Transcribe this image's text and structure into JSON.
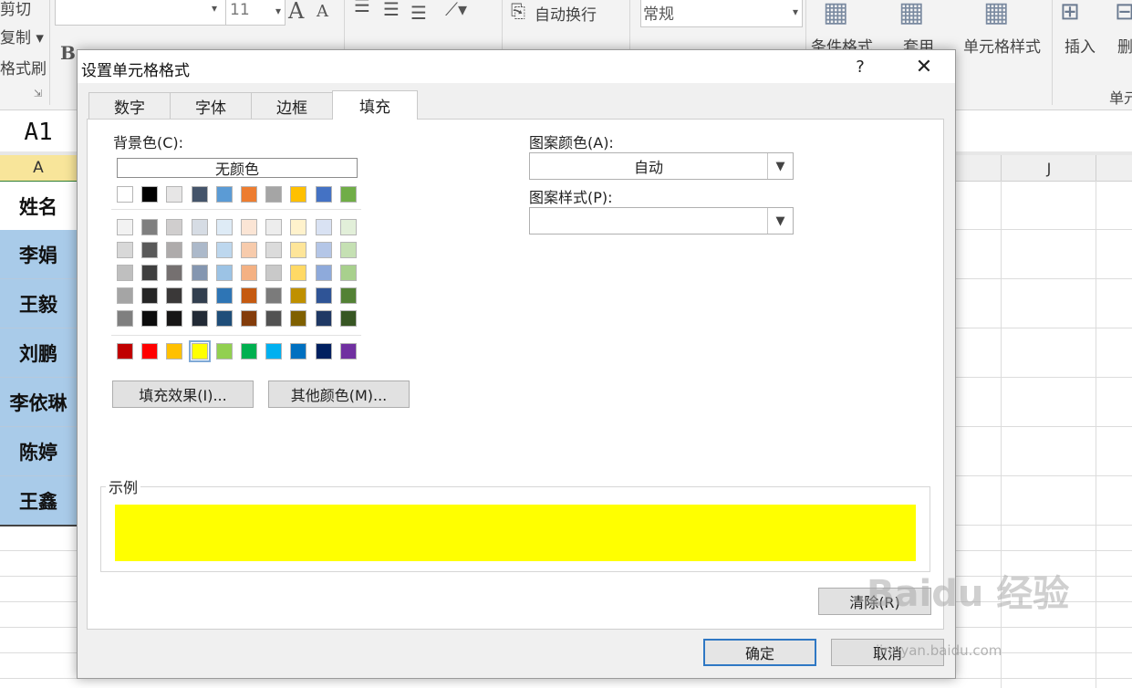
{
  "ribbon": {
    "clipboard": {
      "cut": "剪切",
      "copy": "复制 ▾",
      "format_painter": "格式刷"
    },
    "font": {
      "size": "11",
      "bold": "B",
      "grow": "A",
      "shrink": "A"
    },
    "alignment": {
      "wrap_text": "自动换行"
    },
    "number": {
      "format": "常规"
    },
    "styles": {
      "conditional_formatting": "条件格式",
      "format_as_table": "套用",
      "cell_styles": "单元格样式"
    },
    "cells": {
      "insert": "插入",
      "delete": "删",
      "group_label": "单元"
    }
  },
  "namebox": {
    "value": "A1"
  },
  "sheet": {
    "col_a": "A",
    "col_j": "J",
    "rows": [
      "姓名",
      "李娟",
      "王毅",
      "刘鹏",
      "李依琳",
      "陈婷",
      "王鑫"
    ]
  },
  "dialog": {
    "title": "设置单元格格式",
    "help": "?",
    "close": "✕",
    "tabs": [
      {
        "label": "数字"
      },
      {
        "label": "字体"
      },
      {
        "label": "边框"
      },
      {
        "label": "填充"
      }
    ],
    "active_tab": "填充",
    "fill": {
      "background_label": "背景色(C):",
      "no_color": "无颜色",
      "pattern_color_label": "图案颜色(A):",
      "pattern_color_value": "自动",
      "pattern_style_label": "图案样式(P):",
      "pattern_style_value": "",
      "fill_effects": "填充效果(I)...",
      "more_colors": "其他颜色(M)...",
      "sample_label": "示例",
      "sample_color": "#ffff00",
      "selected_color": "#ffff00",
      "theme_top_row": [
        "#ffffff",
        "#000000",
        "#e7e6e6",
        "#44546a",
        "#5b9bd5",
        "#ed7d31",
        "#a5a5a5",
        "#ffc000",
        "#4472c4",
        "#70ad47"
      ],
      "theme_shades": [
        [
          "#f2f2f2",
          "#7f7f7f",
          "#d0cece",
          "#d6dce4",
          "#deebf6",
          "#fbe5d5",
          "#ededed",
          "#fff2cc",
          "#d9e2f3",
          "#e2efd9"
        ],
        [
          "#d8d8d8",
          "#595959",
          "#aeabab",
          "#acb9ca",
          "#bdd7ee",
          "#f7cbac",
          "#dbdbdb",
          "#fee599",
          "#b4c6e7",
          "#c5e0b3"
        ],
        [
          "#bfbfbf",
          "#3f3f3f",
          "#757070",
          "#8496b0",
          "#9cc3e5",
          "#f4b183",
          "#c9c9c9",
          "#ffd965",
          "#8eaadb",
          "#a8d08d"
        ],
        [
          "#a5a5a5",
          "#262626",
          "#3a3838",
          "#323f4f",
          "#2e75b5",
          "#c55a11",
          "#7b7b7b",
          "#bf9000",
          "#2f5496",
          "#538135"
        ],
        [
          "#7f7f7f",
          "#0c0c0c",
          "#171616",
          "#222a35",
          "#1f4e79",
          "#833c0b",
          "#525252",
          "#7f6000",
          "#1f3864",
          "#375623"
        ]
      ],
      "standard_colors": [
        "#c00000",
        "#ff0000",
        "#ffc000",
        "#ffff00",
        "#92d050",
        "#00b050",
        "#00b0f0",
        "#0070c0",
        "#002060",
        "#7030a0"
      ]
    },
    "clear": "清除(R)",
    "ok": "确定",
    "cancel": "取消"
  },
  "watermark": {
    "brand": "Baidu 经验",
    "url": "jingyan.baidu.com"
  }
}
